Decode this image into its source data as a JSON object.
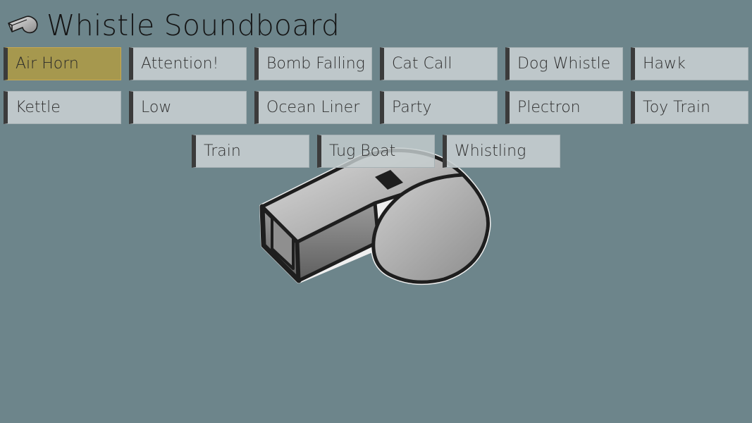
{
  "app": {
    "title": "Whistle Soundboard",
    "icon": "whistle-icon"
  },
  "sounds": [
    {
      "label": "Air Horn",
      "selected": true
    },
    {
      "label": "Attention!"
    },
    {
      "label": "Bomb Falling"
    },
    {
      "label": "Cat Call"
    },
    {
      "label": "Dog Whistle"
    },
    {
      "label": "Hawk"
    },
    {
      "label": "Kettle"
    },
    {
      "label": "Low"
    },
    {
      "label": "Ocean Liner"
    },
    {
      "label": "Party"
    },
    {
      "label": "Plectron"
    },
    {
      "label": "Toy Train"
    },
    {
      "label": "Train"
    },
    {
      "label": "Tug Boat"
    },
    {
      "label": "Whistling"
    }
  ],
  "colors": {
    "background": "#6d858b",
    "button": "#c6ced0",
    "selected_button": "#aa994b",
    "button_accent": "#3b3b3b"
  }
}
